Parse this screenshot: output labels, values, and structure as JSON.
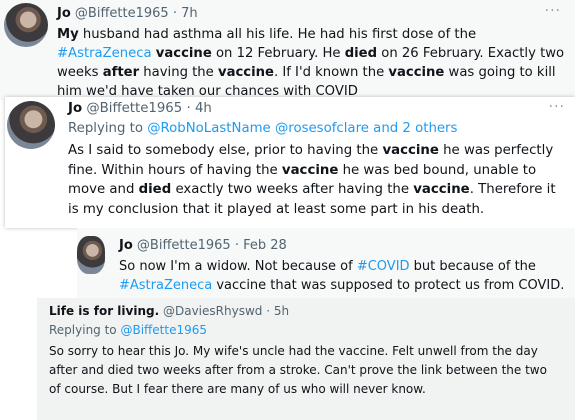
{
  "tweets": [
    {
      "name": "Jo",
      "handle": "@Biffette1965",
      "sep": "·",
      "time": "7h",
      "more": "···",
      "body_parts": [
        {
          "b": "My"
        },
        {
          "t": " husband had asthma all his life. He had his first dose of the "
        },
        {
          "l": "#AstraZeneca"
        },
        {
          "t": " "
        },
        {
          "b": "vaccine"
        },
        {
          "t": " on 12 February. He "
        },
        {
          "b": "died"
        },
        {
          "t": " on 26 February. Exactly two weeks "
        },
        {
          "b": "after"
        },
        {
          "t": " having the "
        },
        {
          "b": "vaccine"
        },
        {
          "t": ". If I'd known the "
        },
        {
          "b": "vaccine"
        },
        {
          "t": " was going to kill him we'd have taken our chances with COVID"
        }
      ]
    },
    {
      "name": "Jo",
      "handle": "@Biffette1965",
      "sep": "·",
      "time": "4h",
      "more": "···",
      "reply_prefix": "Replying to ",
      "reply_parts": [
        {
          "l": "@RobNoLastName"
        },
        {
          "t": " "
        },
        {
          "l": "@rosesofclare"
        },
        {
          "t": " "
        },
        {
          "l": "and 2 others"
        }
      ],
      "body_parts": [
        {
          "t": "As I said to somebody else, prior to having the "
        },
        {
          "b": "vaccine"
        },
        {
          "t": " he was perfectly fine. Within hours of having the "
        },
        {
          "b": "vaccine"
        },
        {
          "t": " he was bed bound, unable to move and "
        },
        {
          "b": "died"
        },
        {
          "t": " exactly two weeks after having the "
        },
        {
          "b": "vaccine"
        },
        {
          "t": ". Therefore it is my conclusion that it played at least some part in his death."
        }
      ]
    },
    {
      "name": "Jo",
      "handle": "@Biffette1965",
      "sep": "·",
      "time": "Feb 28",
      "body_parts": [
        {
          "t": "So now I'm a widow. Not because of "
        },
        {
          "l": "#COVID"
        },
        {
          "t": " but because of the "
        },
        {
          "l": "#AstraZeneca"
        },
        {
          "t": " vaccine that was supposed to protect us from COVID."
        }
      ]
    },
    {
      "name": "Life is for living.",
      "handle": "@DaviesRhyswd",
      "sep": "·",
      "time": "5h",
      "reply_prefix": "Replying to ",
      "reply_parts": [
        {
          "l": "@Biffette1965"
        }
      ],
      "body_parts": [
        {
          "t": "So sorry to hear this Jo. My wife's uncle had the vaccine. Felt unwell from the day after and died two weeks after from a stroke. Can't prove the link between the two of course. But I fear there are many of us who will never know."
        }
      ]
    }
  ]
}
